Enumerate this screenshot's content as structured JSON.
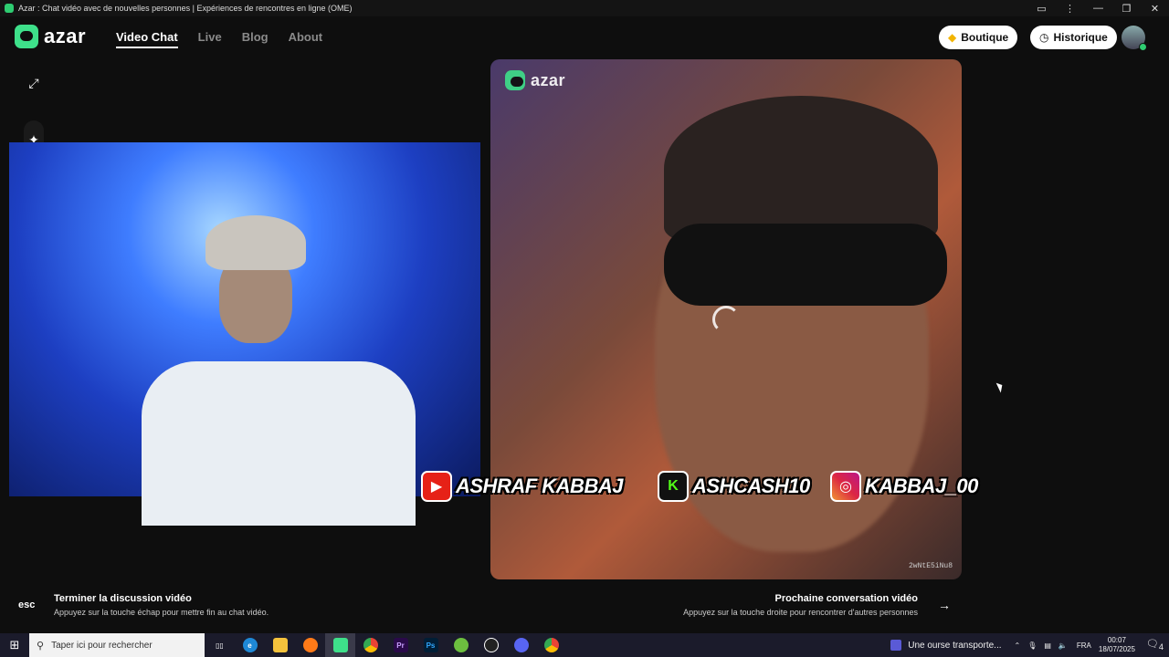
{
  "window": {
    "title": "Azar : Chat vidéo avec de nouvelles personnes | Expériences de rencontres en ligne (OME)",
    "controls": [
      "▭",
      "⋮",
      "—",
      "❐",
      "✕"
    ]
  },
  "brand": {
    "logo_text": "azar",
    "accent": "#3ee08a"
  },
  "nav": {
    "links": [
      "Video Chat",
      "Live",
      "Blog",
      "About"
    ],
    "active": "Video Chat",
    "shop_label": "Boutique",
    "history_label": "Historique"
  },
  "tools": [
    "expand-icon",
    "sparkle-icon",
    "face-icon"
  ],
  "remote": {
    "watermark": "azar",
    "session_code": "2wNtE5iNu8"
  },
  "overlay": {
    "youtube": "ASHRAF KABBAJ",
    "kick": "ASHCASH10",
    "instagram": "KABBAJ_00",
    "kick_letter": "K"
  },
  "footer": {
    "esc_key": "esc",
    "end_title": "Terminer la discussion vidéo",
    "end_sub": "Appuyez sur la touche échap pour mettre fin au chat vidéo.",
    "next_title": "Prochaine conversation vidéo",
    "next_sub": "Appuyez sur la touche droite pour rencontrer d'autres personnes",
    "arrow": "→"
  },
  "taskbar": {
    "search_placeholder": "Taper ici pour rechercher",
    "now_playing": "Une ourse transporte...",
    "language": "FRA",
    "time": "00:07",
    "date": "18/07/2025",
    "notification_count": "4",
    "apps": [
      "task-view",
      "edge",
      "explorer",
      "firefox",
      "azar",
      "chrome",
      "premiere",
      "photoshop",
      "utorrent",
      "obs",
      "discord",
      "chrome2"
    ],
    "premiere_label": "Pr",
    "photoshop_label": "Ps"
  }
}
